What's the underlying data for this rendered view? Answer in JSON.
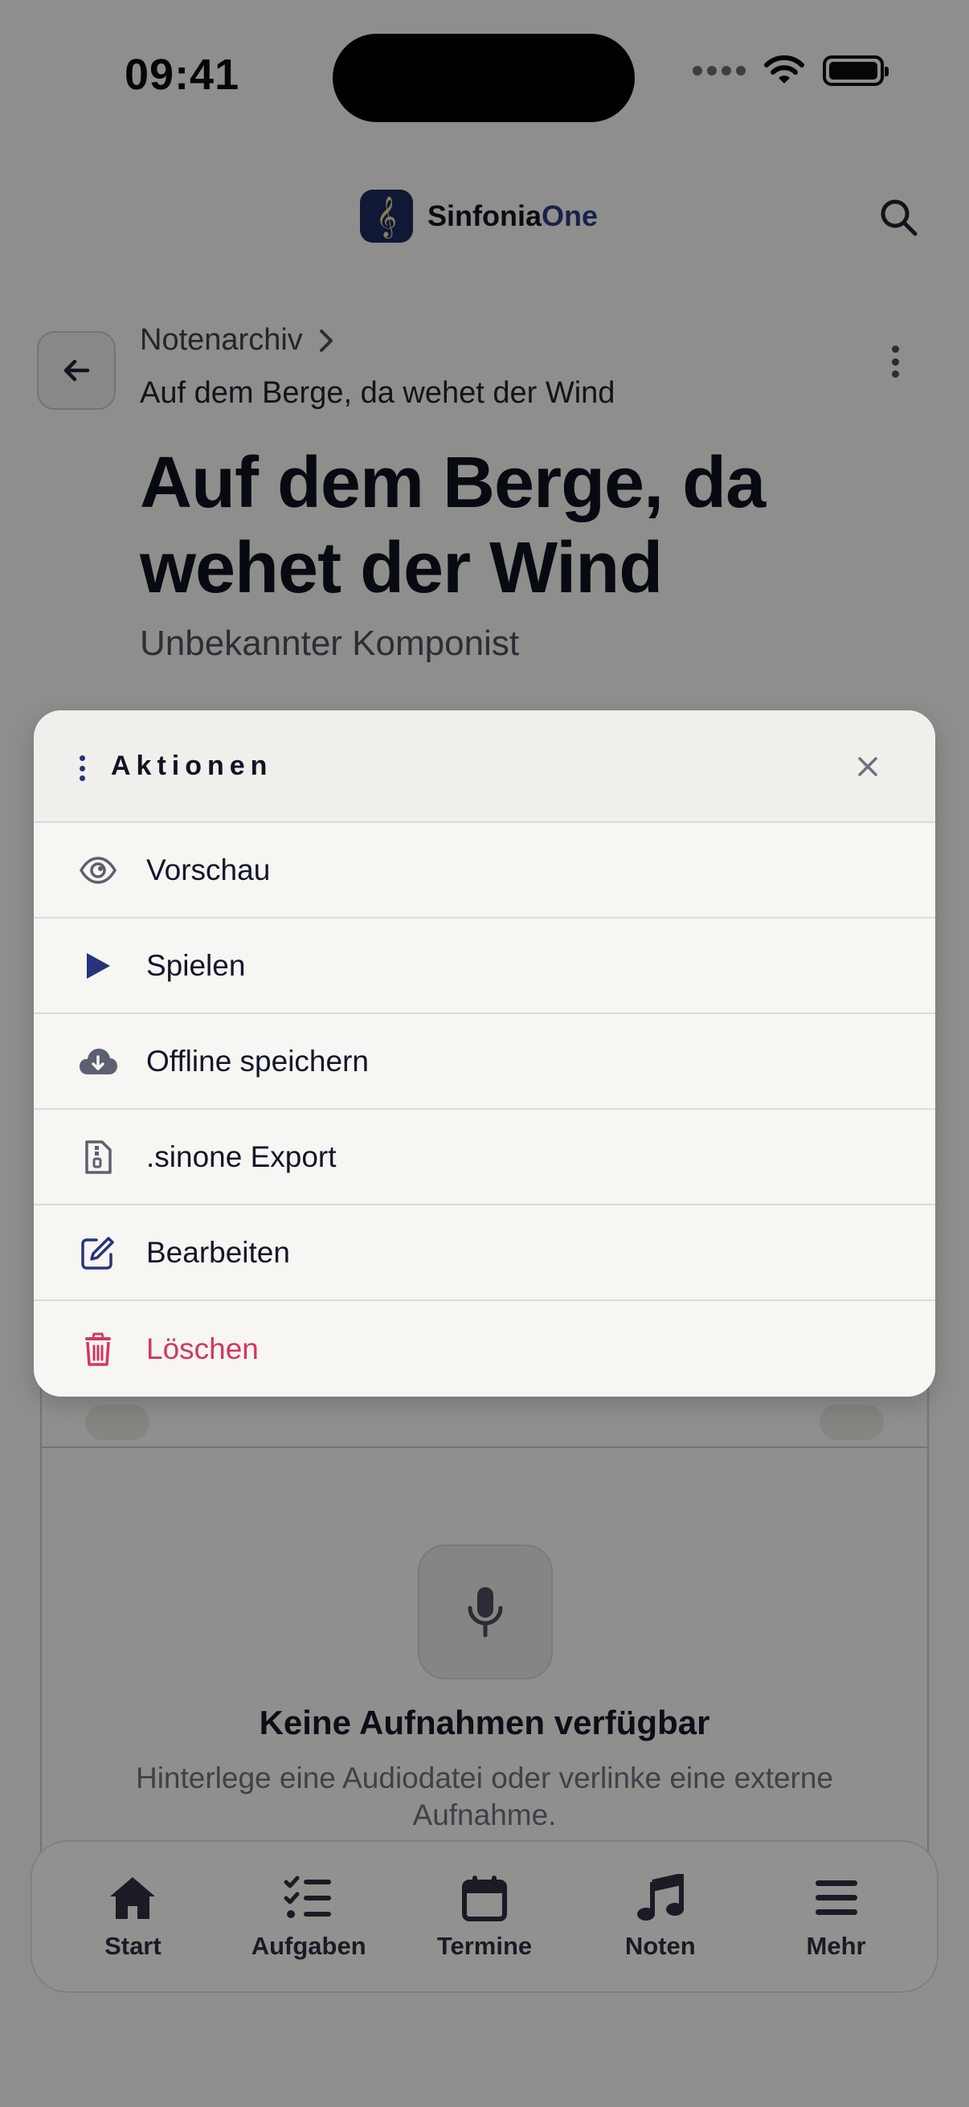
{
  "status": {
    "time": "09:41"
  },
  "header": {
    "app_name_a": "Sinfonia",
    "app_name_b": "One",
    "logo_glyph": "𝄞"
  },
  "breadcrumb": {
    "parent": "Notenarchiv",
    "current": "Auf dem Berge, da wehet der Wind"
  },
  "piece": {
    "title": "Auf dem Berge, da wehet der Wind",
    "composer": "Unbekannter Komponist"
  },
  "recordings": {
    "empty_title": "Keine Aufnahmen verfügbar",
    "empty_subtitle": "Hinterlege eine Audiodatei oder verlinke eine externe Aufnahme."
  },
  "tabbar": {
    "items": [
      {
        "label": "Start",
        "icon": "home-icon"
      },
      {
        "label": "Aufgaben",
        "icon": "checklist-icon"
      },
      {
        "label": "Termine",
        "icon": "calendar-icon"
      },
      {
        "label": "Noten",
        "icon": "music-note-icon"
      },
      {
        "label": "Mehr",
        "icon": "menu-icon"
      }
    ]
  },
  "sheet": {
    "title": "Aktionen",
    "actions": [
      {
        "label": "Vorschau",
        "icon": "eye-icon"
      },
      {
        "label": "Spielen",
        "icon": "play-icon"
      },
      {
        "label": "Offline speichern",
        "icon": "cloud-download-icon"
      },
      {
        "label": ".sinone Export",
        "icon": "file-export-icon"
      },
      {
        "label": "Bearbeiten",
        "icon": "edit-icon"
      },
      {
        "label": "Löschen",
        "icon": "trash-icon"
      }
    ]
  },
  "colors": {
    "brand": "#27347a",
    "danger": "#d2385d",
    "background": "#f5f4f1"
  }
}
